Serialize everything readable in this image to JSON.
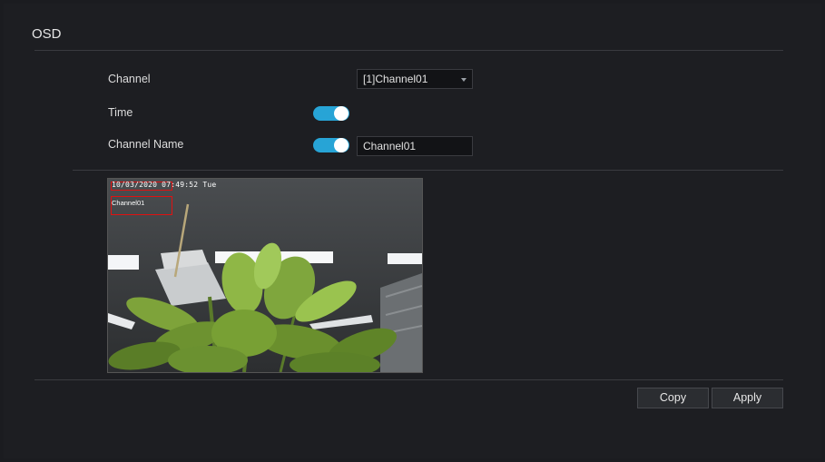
{
  "page": {
    "title": "OSD"
  },
  "form": {
    "channel_label": "Channel",
    "channel_value": "[1]Channel01",
    "time_label": "Time",
    "time_enabled": true,
    "channel_name_label": "Channel Name",
    "channel_name_enabled": true,
    "channel_name_value": "Channel01"
  },
  "preview": {
    "osd_time": "10/03/2020 07:49:52 Tue",
    "osd_channel_name": "Channel01"
  },
  "buttons": {
    "copy": "Copy",
    "apply": "Apply"
  },
  "colors": {
    "accent": "#27a4d6",
    "osd_box": "#e11111",
    "background": "#1d1e22"
  }
}
